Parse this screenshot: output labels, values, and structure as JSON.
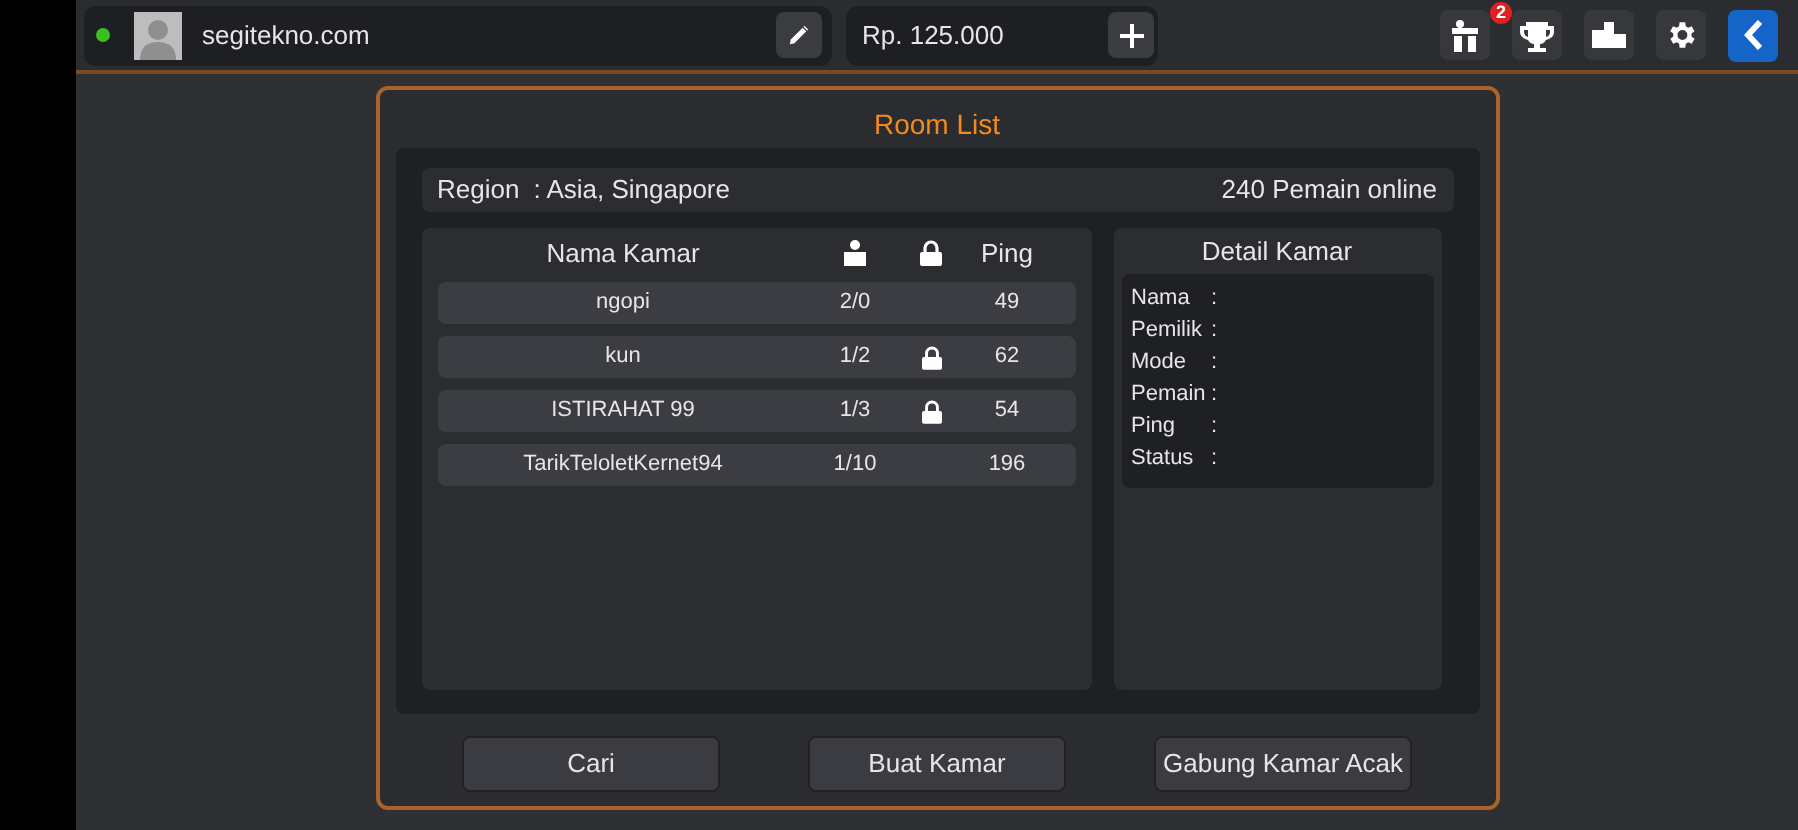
{
  "top_bar": {
    "online": true,
    "username": "segitekno.com",
    "balance": "Rp. 125.000",
    "gift_badge": "2"
  },
  "dialog": {
    "title": "Room List",
    "region_label": "Region",
    "region_value": ": Asia, Singapore",
    "online_count": "240 Pemain online",
    "room_table": {
      "columns": [
        "Nama Kamar",
        "Ping"
      ],
      "rows": [
        {
          "name": "ngopi",
          "players": "2/0",
          "locked": false,
          "ping": "49"
        },
        {
          "name": "kun",
          "players": "1/2",
          "locked": true,
          "ping": "62"
        },
        {
          "name": "ISTIRAHAT 99",
          "players": "1/3",
          "locked": true,
          "ping": "54"
        },
        {
          "name": "TarikTeloletKernet94",
          "players": "1/10",
          "locked": false,
          "ping": "196"
        }
      ]
    },
    "detail": {
      "title": "Detail Kamar",
      "fields": [
        "Nama",
        "Pemilik",
        "Mode",
        "Pemain",
        "Ping",
        "Status"
      ],
      "separator": ":"
    },
    "buttons": [
      "Cari",
      "Buat Kamar",
      "Gabung Kamar Acak"
    ]
  }
}
